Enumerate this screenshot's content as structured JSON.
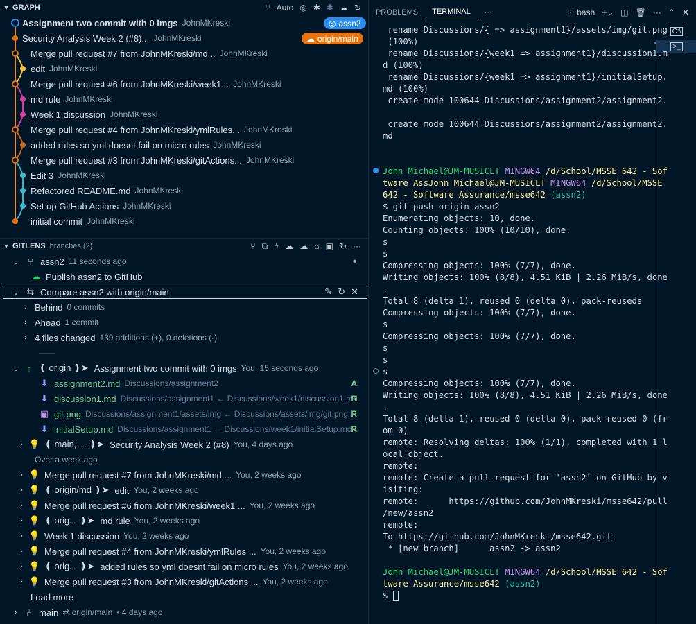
{
  "graph": {
    "title": "GRAPH",
    "auto_label": "Auto",
    "branch_badge": "assn2",
    "origin_badge": "origin/main",
    "commits": [
      {
        "message": "Assignment two commit with 0 imgs",
        "author": "JohnMKreski",
        "bold": true
      },
      {
        "message": "Security Analysis Week 2 (#8)...",
        "author": "JohnMKreski"
      },
      {
        "message": "Merge pull request #7 from JohnMKreski/md...",
        "author": "JohnMKreski"
      },
      {
        "message": "edit",
        "author": "JohnMKreski"
      },
      {
        "message": "Merge pull request #6 from JohnMKreski/week1...",
        "author": "JohnMKreski"
      },
      {
        "message": "md rule",
        "author": "JohnMKreski"
      },
      {
        "message": "Week 1 discussion",
        "author": "JohnMKreski"
      },
      {
        "message": "Merge pull request #4 from JohnMKreski/ymlRules...",
        "author": "JohnMKreski"
      },
      {
        "message": "added rules so yml doesnt fail on micro rules",
        "author": "JohnMKreski"
      },
      {
        "message": "Merge pull request #3 from JohnMKreski/gitActions...",
        "author": "JohnMKreski"
      },
      {
        "message": "Edit 3",
        "author": "JohnMKreski"
      },
      {
        "message": "Refactored README.md",
        "author": "JohnMKreski"
      },
      {
        "message": "Set up GitHub Actions",
        "author": "JohnMKreski"
      },
      {
        "message": "initial commit",
        "author": "JohnMKreski"
      }
    ],
    "colors": {
      "blue": "#2b8ff0",
      "orange": "#e8720c",
      "yellow": "#f4c542",
      "pink": "#d63ea3",
      "brown": "#c86b1e",
      "teal": "#3fb6c4",
      "line_orange": "#e09040"
    }
  },
  "gitlens": {
    "title": "GITLENS",
    "subtitle": "branches (2)",
    "branch": {
      "name": "assn2",
      "time": "11 seconds ago"
    },
    "publish": "Publish assn2 to GitHub",
    "compare": "Compare assn2 with origin/main",
    "behind": {
      "label": "Behind",
      "count": "0 commits"
    },
    "ahead": {
      "label": "Ahead",
      "count": "1 commit"
    },
    "changed": {
      "label": "4 files changed",
      "detail": "139 additions (+), 0 deletions (-)"
    },
    "separator": "——",
    "origin_commit": {
      "ref": "❪ origin ❫➤",
      "message": "Assignment two commit with 0 imgs",
      "time": "You, 15 seconds ago"
    },
    "files": [
      {
        "name": "assignment2.md",
        "path": "Discussions/assignment2",
        "status": "A",
        "icon": "down-arrow-icon"
      },
      {
        "name": "discussion1.md",
        "path": "Discussions/assignment1 ← Discussions/week1/discussion1.md",
        "status": "R",
        "icon": "down-arrow-icon"
      },
      {
        "name": "git.png",
        "path": "Discussions/assignment1/assets/img ← Discussions/assets/img/git.png",
        "status": "R",
        "icon": "image-icon"
      },
      {
        "name": "initialSetup.md",
        "path": "Discussions/assignment1 ← Discussions/week1/initialSetup.md",
        "status": "R",
        "icon": "down-arrow-icon"
      }
    ],
    "main_commit": {
      "ref": "❪ main, ... ❫➤",
      "message": "Security Analysis Week 2 (#8)",
      "time": "You, 4 days ago"
    },
    "over_week": "Over a week ago",
    "old_commits": [
      {
        "ref": "",
        "message": "Merge pull request #7 from JohnMKreski/md ...",
        "time": "You, 2 weeks ago"
      },
      {
        "ref": "❪ origin/md ❫➤",
        "message": "edit",
        "time": "You, 2 weeks ago"
      },
      {
        "ref": "",
        "message": "Merge pull request #6 from JohnMKreski/week1 ...",
        "time": "You, 2 weeks ago"
      },
      {
        "ref": "❪ orig... ❫➤",
        "message": "md rule",
        "time": "You, 2 weeks ago"
      },
      {
        "ref": "",
        "message": "Week 1 discussion",
        "time": "You, 2 weeks ago"
      },
      {
        "ref": "",
        "message": "Merge pull request #4 from JohnMKreski/ymlRules ...",
        "time": "You, 2 weeks ago"
      },
      {
        "ref": "❪ orig... ❫➤",
        "message": "added rules so yml doesnt fail on micro rules",
        "time": "You, 2 weeks ago"
      },
      {
        "ref": "",
        "message": "Merge pull request #3 from JohnMKreski/gitActions ...",
        "time": "You, 2 weeks ago"
      }
    ],
    "load_more": "Load more",
    "main_branch": {
      "name": "main",
      "tracking": "⇄ origin/main",
      "time": "• 4 days ago"
    }
  },
  "panel": {
    "tabs": [
      "PROBLEMS",
      "TERMINAL"
    ],
    "more": "···",
    "shell": "bash"
  },
  "terminal": {
    "lines": [
      " rename Discussions/{ => assignment1}/assets/img/git.png",
      " (100%)",
      " rename Discussions/{week1 => assignment1}/discussion1.m",
      "d (100%)",
      " rename Discussions/{week1 => assignment1}/initialSetup.",
      "md (100%)",
      " create mode 100644 Discussions/assignment2/assignment2.",
      "",
      " create mode 100644 Discussions/assignment2/assignment2.",
      "md",
      "",
      ""
    ],
    "prompt1": {
      "user": "John Michael@JM-MUSICLT",
      "sys": "MINGW64",
      "path": "/d/School/MSSE 642 - Sof",
      "path2": "tware AssJohn Michael@JM-MUSICLT",
      "sys2": "MINGW64",
      "path3": "/d/School/MSSE",
      "path4": "642 - Software Assurance/msse642",
      "branch": "(assn2)"
    },
    "output": [
      "$ git push origin assn2",
      "Enumerating objects: 10, done.",
      "Counting objects: 100% (10/10), done.",
      "s",
      "s",
      "Compressing objects: 100% (7/7), done.",
      "Writing objects: 100% (8/8), 4.51 KiB | 2.26 MiB/s, done",
      ".",
      "Total 8 (delta 1), reused 0 (delta 0), pack-reuseds",
      "Compressing objects: 100% (7/7), done.",
      "s",
      "Compressing objects: 100% (7/7), done.",
      "s",
      "s",
      "s",
      "Compressing objects: 100% (7/7), done.",
      "Writing objects: 100% (8/8), 4.51 KiB | 2.26 MiB/s, done",
      ".",
      "Total 8 (delta 1), reused 0 (delta 0), pack-reused 0 (fr",
      "om 0)",
      "remote: Resolving deltas: 100% (1/1), completed with 1 l",
      "ocal object.",
      "remote:",
      "remote: Create a pull request for 'assn2' on GitHub by v",
      "isiting:",
      "remote:      https://github.com/JohnMKreski/msse642/pull",
      "/new/assn2",
      "remote:",
      "To https://github.com/JohnMKreski/msse642.git",
      " * [new branch]      assn2 -> assn2",
      ""
    ],
    "prompt2": {
      "user": "John Michael@JM-MUSICLT",
      "sys": "MINGW64",
      "path": "/d/School/MSSE 642 - Sof",
      "path2": "tware Assurance/msse642",
      "branch": "(assn2)"
    },
    "cursor_prompt": "$ "
  }
}
